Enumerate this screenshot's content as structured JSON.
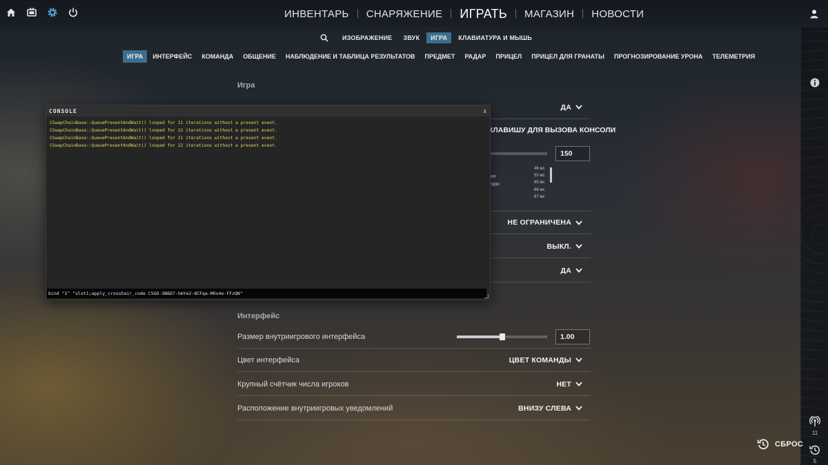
{
  "topbar": {
    "icons": [
      "home-icon",
      "tv-icon",
      "settings-gear-icon",
      "power-icon"
    ],
    "nav": [
      "ИНВЕНТАРЬ",
      "СНАРЯЖЕНИЕ",
      "ИГРАТЬ",
      "МАГАЗИН",
      "НОВОСТИ"
    ],
    "profile_icon": "user-icon"
  },
  "subnav": {
    "items": [
      "ИЗОБРАЖЕНИЕ",
      "ЗВУК",
      "ИГРА",
      "КЛАВИАТУРА И МЫШЬ"
    ],
    "active": "ИГРА"
  },
  "tabs": {
    "items": [
      "ИГРА",
      "ИНТЕРФЕЙС",
      "КОМАНДА",
      "ОБЩЕНИЕ",
      "НАБЛЮДЕНИЕ И ТАБЛИЦА РЕЗУЛЬТАТОВ",
      "ПРЕДМЕТ",
      "РАДАР",
      "ПРИЦЕЛ",
      "ПРИЦЕЛ ДЛЯ ГРАНАТЫ",
      "ПРОГНОЗИРОВАНИЕ УРОНА",
      "ТЕЛЕМЕТРИЯ"
    ],
    "active": "ИГРА"
  },
  "game_section": {
    "title": "Игра",
    "row1_value": "ДА",
    "console_key_label": "КЛАВИШУ ДЛЯ ВЫЗОВА КОНСОЛИ",
    "slider_value": "150",
    "slider_level": 0.05,
    "partial_1": "ия",
    "partial_2": "нды",
    "net_graph": [
      "46 мс",
      "53 мс",
      "65 мс",
      "66 мс",
      "67 мс"
    ],
    "row_limit_value": "НЕ ОГРАНИЧЕНА",
    "row_off_value": "ВЫКЛ.",
    "row_yes_value": "ДА"
  },
  "interface_section": {
    "title": "Интерфейс",
    "hud_scale": {
      "label": "Размер внутриигрового интерфейса",
      "value": "1.00",
      "level": 0.5
    },
    "hud_color": {
      "label": "Цвет интерфейса",
      "value": "ЦВЕТ КОМАНДЫ"
    },
    "player_counter": {
      "label": "Крупный счётчик числа игроков",
      "value": "НЕТ"
    },
    "notifications": {
      "label": "Расположение внутриигровых уведомлений",
      "value": "ВНИЗУ СЛЕВА"
    }
  },
  "console": {
    "title": "CONSOLE",
    "close": "x",
    "lines": [
      "CSwapChainBase::QueuePresentAndWait() looped for 21 iterations without a present event.",
      "CSwapChainBase::QueuePresentAndWait() looped for 22 iterations without a present event.",
      "CSwapChainBase::QueuePresentAndWait() looped for 21 iterations without a present event.",
      "CSwapChainBase::QueuePresentAndWait() looped for 22 iterations without a present event."
    ],
    "input": "bind \"1\" \"slot1;apply_crosshair_code CSGO-3B6D7-hmYe2-8CFqa-MOs4e-FFzQN\""
  },
  "rightrail": {
    "info_icon": "info-icon",
    "broadcast_count": "11",
    "history_count": "5"
  },
  "reset": {
    "label": "СБРОС"
  },
  "colors": {
    "accent": "#3c6e8f",
    "console_text": "#e5d85c"
  }
}
